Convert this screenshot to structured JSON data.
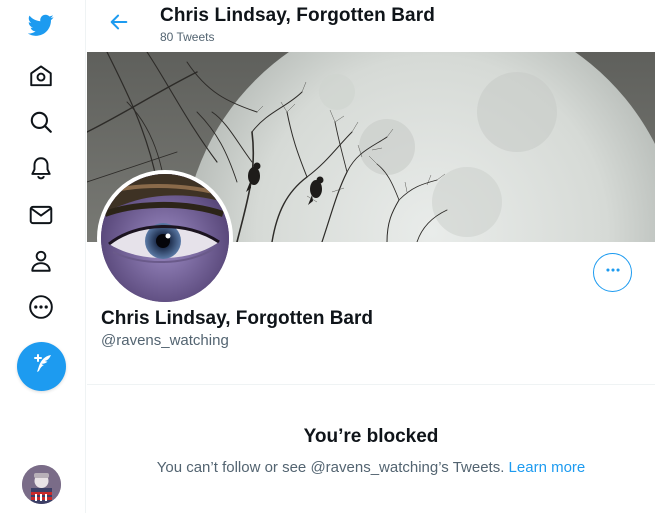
{
  "colors": {
    "accent": "#1d9bf0",
    "text_primary": "#0f1419",
    "text_secondary": "#536471"
  },
  "sidebar": {
    "logo_icon": "twitter-bird-icon",
    "items": [
      {
        "name": "home",
        "icon": "home-icon"
      },
      {
        "name": "explore",
        "icon": "search-icon"
      },
      {
        "name": "notifications",
        "icon": "bell-icon"
      },
      {
        "name": "messages",
        "icon": "mail-icon"
      },
      {
        "name": "profile",
        "icon": "person-icon"
      },
      {
        "name": "more",
        "icon": "more-circle-icon"
      }
    ],
    "tweet_button_icon": "feather-plus-icon",
    "account_avatar": "account-avatar"
  },
  "header": {
    "title": "Chris Lindsay, Forgotten Bard",
    "subtitle": "80 Tweets"
  },
  "profile": {
    "name": "Chris Lindsay, Forgotten Bard",
    "handle": "@ravens_watching",
    "more_icon": "ellipsis-icon"
  },
  "blocked": {
    "title": "You’re blocked",
    "message": "You can’t follow or see @ravens_watching’s Tweets. ",
    "link": "Learn more"
  }
}
